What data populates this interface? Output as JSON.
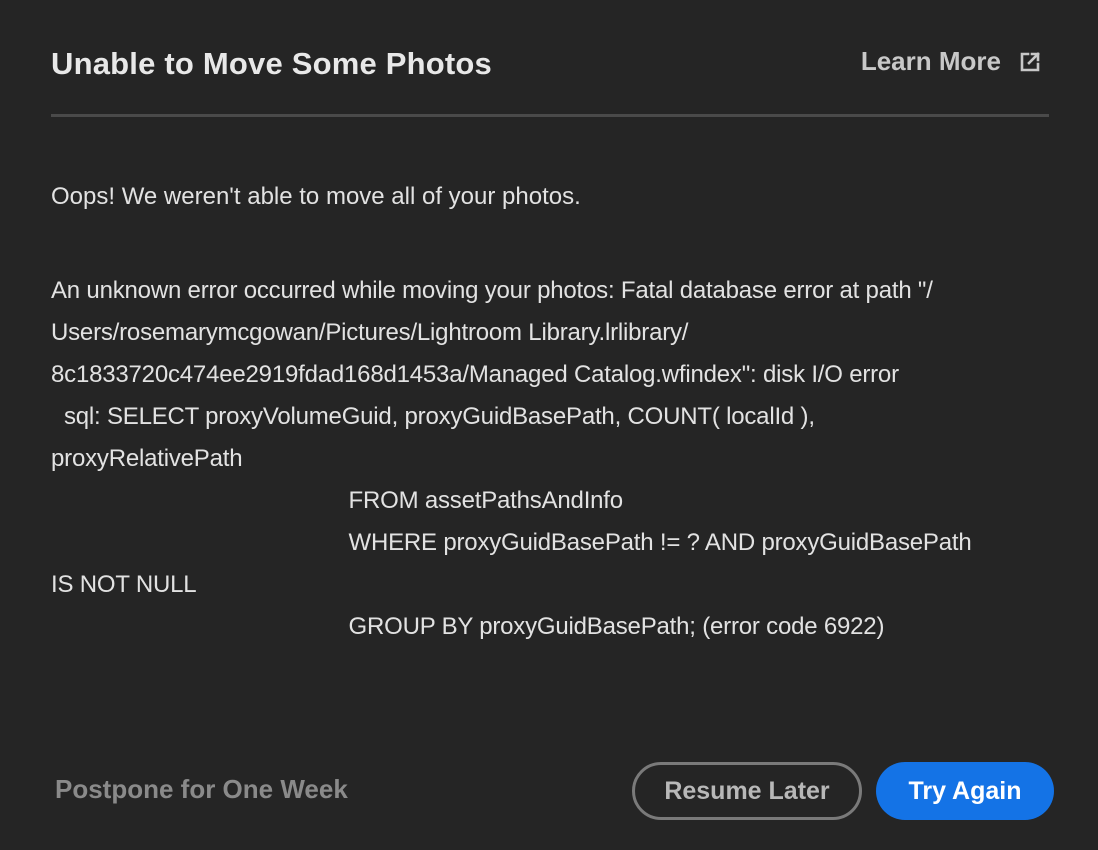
{
  "dialog": {
    "title": "Unable to Move Some Photos",
    "learn_more_label": "Learn More",
    "learn_more_icon": "external-link-icon",
    "message": "Oops! We weren't able to move all of your photos.",
    "error_details": "An unknown error occurred while moving your photos: Fatal database error at path \"/\nUsers/rosemarymcgowan/Pictures/Lightroom Library.lrlibrary/\n8c1833720c474ee2919fdad168d1453a/Managed Catalog.wfindex\": disk I/O error\n  sql: SELECT proxyVolumeGuid, proxyGuidBasePath, COUNT( localId ),\nproxyRelativePath\n                                              FROM assetPathsAndInfo\n                                              WHERE proxyGuidBasePath != ? AND proxyGuidBasePath\nIS NOT NULL\n                                              GROUP BY proxyGuidBasePath; (error code 6922)"
  },
  "footer": {
    "postpone_label": "Postpone for One Week",
    "resume_label": "Resume Later",
    "try_again_label": "Try Again"
  },
  "colors": {
    "background": "#252525",
    "accent": "#1473e6",
    "divider": "#4a4a4a"
  }
}
